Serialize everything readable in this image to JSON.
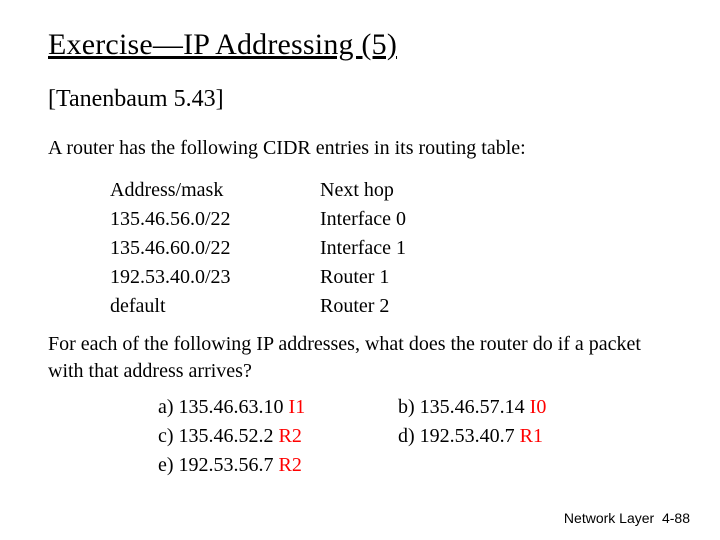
{
  "title": "Exercise—IP Addressing (5)",
  "subtitle": "[Tanenbaum 5.43]",
  "prompt": "A router has the following CIDR entries in its routing table:",
  "table": {
    "header": {
      "addr": "Address/mask",
      "hop": "Next hop"
    },
    "rows": [
      {
        "addr": "135.46.56.0/22",
        "hop": "Interface 0"
      },
      {
        "addr": "135.46.60.0/22",
        "hop": "Interface 1"
      },
      {
        "addr": "192.53.40.0/23",
        "hop": "Router 1"
      },
      {
        "addr": "default",
        "hop": "Router 2"
      }
    ]
  },
  "question": "For each of the following IP addresses, what does the router do if a packet with that address arrives?",
  "options": [
    {
      "label": "a) 135.46.63.10",
      "ans": "I1"
    },
    {
      "label": "b) 135.46.57.14",
      "ans": "I0"
    },
    {
      "label": "c) 135.46.52.2",
      "ans": "R2"
    },
    {
      "label": "d) 192.53.40.7",
      "ans": "R1"
    },
    {
      "label": "e) 192.53.56.7",
      "ans": "R2"
    }
  ],
  "footer": {
    "section": "Network Layer",
    "page": "4-88"
  }
}
